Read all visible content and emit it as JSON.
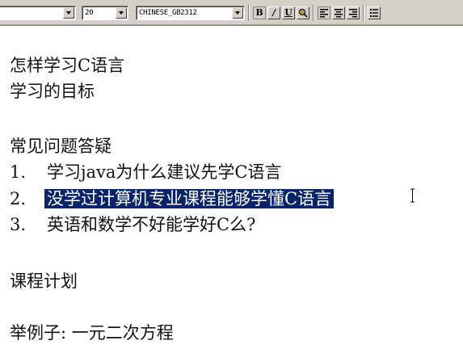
{
  "toolbar": {
    "font_name": "",
    "font_size": "20",
    "charset": "CHINESE_GB2312",
    "bold_label": "B",
    "italic_label": "/",
    "underline_label": "U",
    "icons": [
      "color-icon",
      "align-left-icon",
      "align-center-icon",
      "align-right-icon",
      "bullet-list-icon"
    ]
  },
  "document": {
    "line1": "怎样学习C语言",
    "line2": "学习的目标",
    "line3": "常见问题答疑",
    "faq": [
      {
        "num": "1.",
        "text": "学习java为什么建议先学C语言"
      },
      {
        "num": "2.",
        "text": "没学过计算机专业课程能够学懂C语言"
      },
      {
        "num": "3.",
        "text": "英语和数学不好能学好C么?"
      }
    ],
    "line7": "课程计划",
    "line8": "举例子: 一元二次方程"
  },
  "colors": {
    "toolbar_bg": "#d4d0c8",
    "selection_bg": "#0a246a",
    "selection_fg": "#ffffff",
    "text": "#111111"
  }
}
